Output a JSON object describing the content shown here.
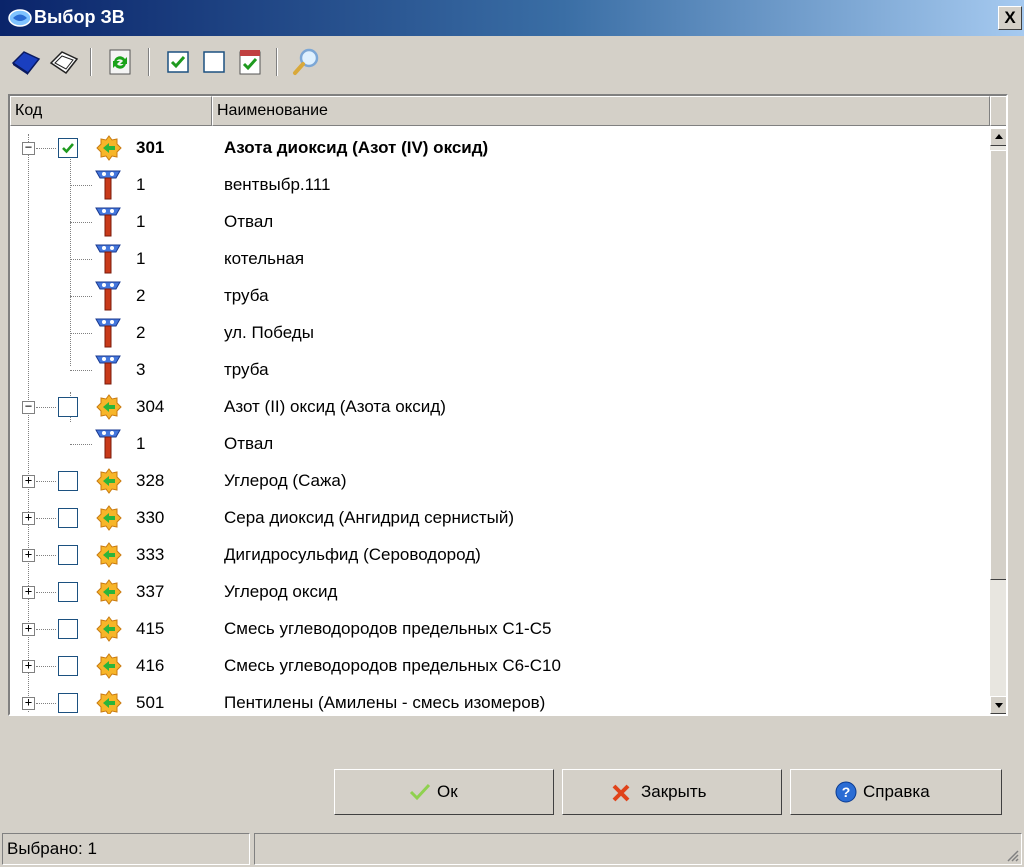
{
  "window": {
    "title": "Выбор ЗВ",
    "close_label": "X"
  },
  "toolbar": {
    "buttons": [
      "select-all-icon",
      "deselect-all-icon",
      "refresh-icon",
      "check-all-icon",
      "uncheck-all-icon",
      "check-list-icon",
      "search-icon"
    ]
  },
  "grid": {
    "columns": [
      "Код",
      "Наименование"
    ],
    "rows": [
      {
        "code": "301",
        "name": "Азота диоксид (Азот (IV) оксид)"
      },
      {
        "code": "1",
        "name": "вентвыбр.111"
      },
      {
        "code": "1",
        "name": "Отвал"
      },
      {
        "code": "1",
        "name": "котельная"
      },
      {
        "code": "2",
        "name": "труба"
      },
      {
        "code": "2",
        "name": "ул. Победы"
      },
      {
        "code": "3",
        "name": "труба"
      },
      {
        "code": "304",
        "name": "Азот (II) оксид (Азота оксид)"
      },
      {
        "code": "1",
        "name": "Отвал"
      },
      {
        "code": "328",
        "name": "Углерод (Сажа)"
      },
      {
        "code": "330",
        "name": "Сера диоксид (Ангидрид сернистый)"
      },
      {
        "code": "333",
        "name": "Дигидросульфид (Сероводород)"
      },
      {
        "code": "337",
        "name": "Углерод оксид"
      },
      {
        "code": "415",
        "name": "Смесь углеводородов предельных С1-С5"
      },
      {
        "code": "416",
        "name": "Смесь углеводородов предельных С6-С10"
      },
      {
        "code": "501",
        "name": "Пентилены (Амилены - смесь изомеров)"
      }
    ]
  },
  "buttons": {
    "ok": "Ок",
    "close": "Закрыть",
    "help": "Справка"
  },
  "status": {
    "selected": "Выбрано: 1"
  },
  "colors": {
    "titlebar_start": "#0a246a",
    "titlebar_end": "#a6caf0",
    "face": "#d4d0c8",
    "check_green": "#1f9a1f"
  }
}
